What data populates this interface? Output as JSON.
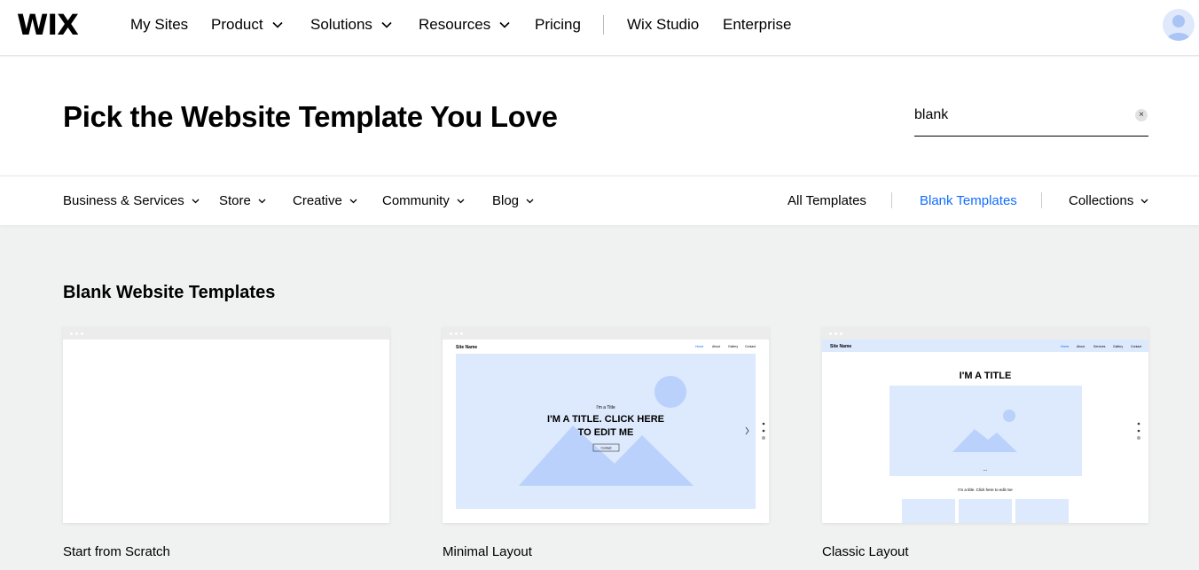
{
  "brand": {
    "logo": "WIX"
  },
  "nav": {
    "items": [
      {
        "label": "My Sites",
        "dropdown": false
      },
      {
        "label": "Product",
        "dropdown": true
      },
      {
        "label": "Solutions",
        "dropdown": true
      },
      {
        "label": "Resources",
        "dropdown": true
      },
      {
        "label": "Pricing",
        "dropdown": false
      },
      {
        "label": "Wix Studio",
        "dropdown": false
      },
      {
        "label": "Enterprise",
        "dropdown": false
      }
    ]
  },
  "hero": {
    "title": "Pick the Website Template You Love",
    "search_value": "blank",
    "clear_icon": "×"
  },
  "categories": {
    "left": [
      {
        "label": "Business & Services"
      },
      {
        "label": "Store"
      },
      {
        "label": "Creative"
      },
      {
        "label": "Community"
      },
      {
        "label": "Blog"
      }
    ],
    "right": [
      {
        "label": "All Templates"
      },
      {
        "label": "Blank Templates",
        "active": true
      },
      {
        "label": "Collections",
        "dropdown": true
      }
    ]
  },
  "section": {
    "title": "Blank Website Templates"
  },
  "cards": [
    {
      "label": "Start from Scratch"
    },
    {
      "label": "Minimal Layout",
      "preview": {
        "site_name": "Site Name",
        "menu": [
          "Home",
          "About",
          "Gallery",
          "Contact"
        ],
        "kicker": "I'm a Title",
        "headline_line1": "I'M A TITLE. CLICK HERE",
        "headline_line2": "TO EDIT ME",
        "button": "Contact"
      }
    },
    {
      "label": "Classic Layout",
      "preview": {
        "site_name": "Site Name",
        "menu": [
          "Home",
          "About",
          "Services",
          "Gallery",
          "Contact"
        ],
        "headline": "I'M A TITLE",
        "dots": "...",
        "caption": "I'm a title. Click here to edit me"
      }
    }
  ],
  "colors": {
    "accent": "#116dff",
    "preview_fill": "#dde9fd",
    "mountain": "#b9d1fb",
    "background": "#f0f1f1"
  }
}
